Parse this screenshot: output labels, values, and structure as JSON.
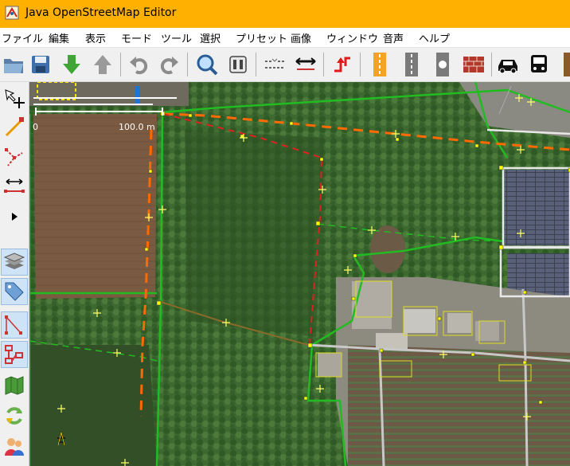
{
  "window": {
    "title": "Java OpenStreetMap Editor"
  },
  "menu": [
    "ファイル",
    "編集",
    "表示",
    "モード",
    "ツール",
    "選択",
    "プリセット",
    "画像",
    "ウィンドウ",
    "音声",
    "ヘルプ"
  ],
  "toolbar": [
    {
      "name": "open-icon"
    },
    {
      "name": "save-icon"
    },
    {
      "name": "download-icon"
    },
    {
      "name": "upload-icon"
    },
    {
      "name": "undo-icon"
    },
    {
      "name": "redo-icon"
    },
    {
      "name": "search-icon"
    },
    {
      "name": "preferences-icon"
    },
    {
      "name": "combine-way-icon"
    },
    {
      "name": "split-way-icon"
    },
    {
      "name": "reverse-way-icon"
    },
    {
      "name": "preset-highway-icon"
    },
    {
      "name": "preset-road-icon"
    },
    {
      "name": "preset-node-icon"
    },
    {
      "name": "preset-wall-icon"
    },
    {
      "name": "preset-car-icon"
    },
    {
      "name": "preset-bus-icon"
    }
  ],
  "map": {
    "scale_start": "0",
    "scale_end": "100.0 m"
  },
  "colors": {
    "titlebar": "#ffb000",
    "way_green": "#22bb22",
    "way_orange": "#ff6a00",
    "way_red": "#dd2222"
  }
}
